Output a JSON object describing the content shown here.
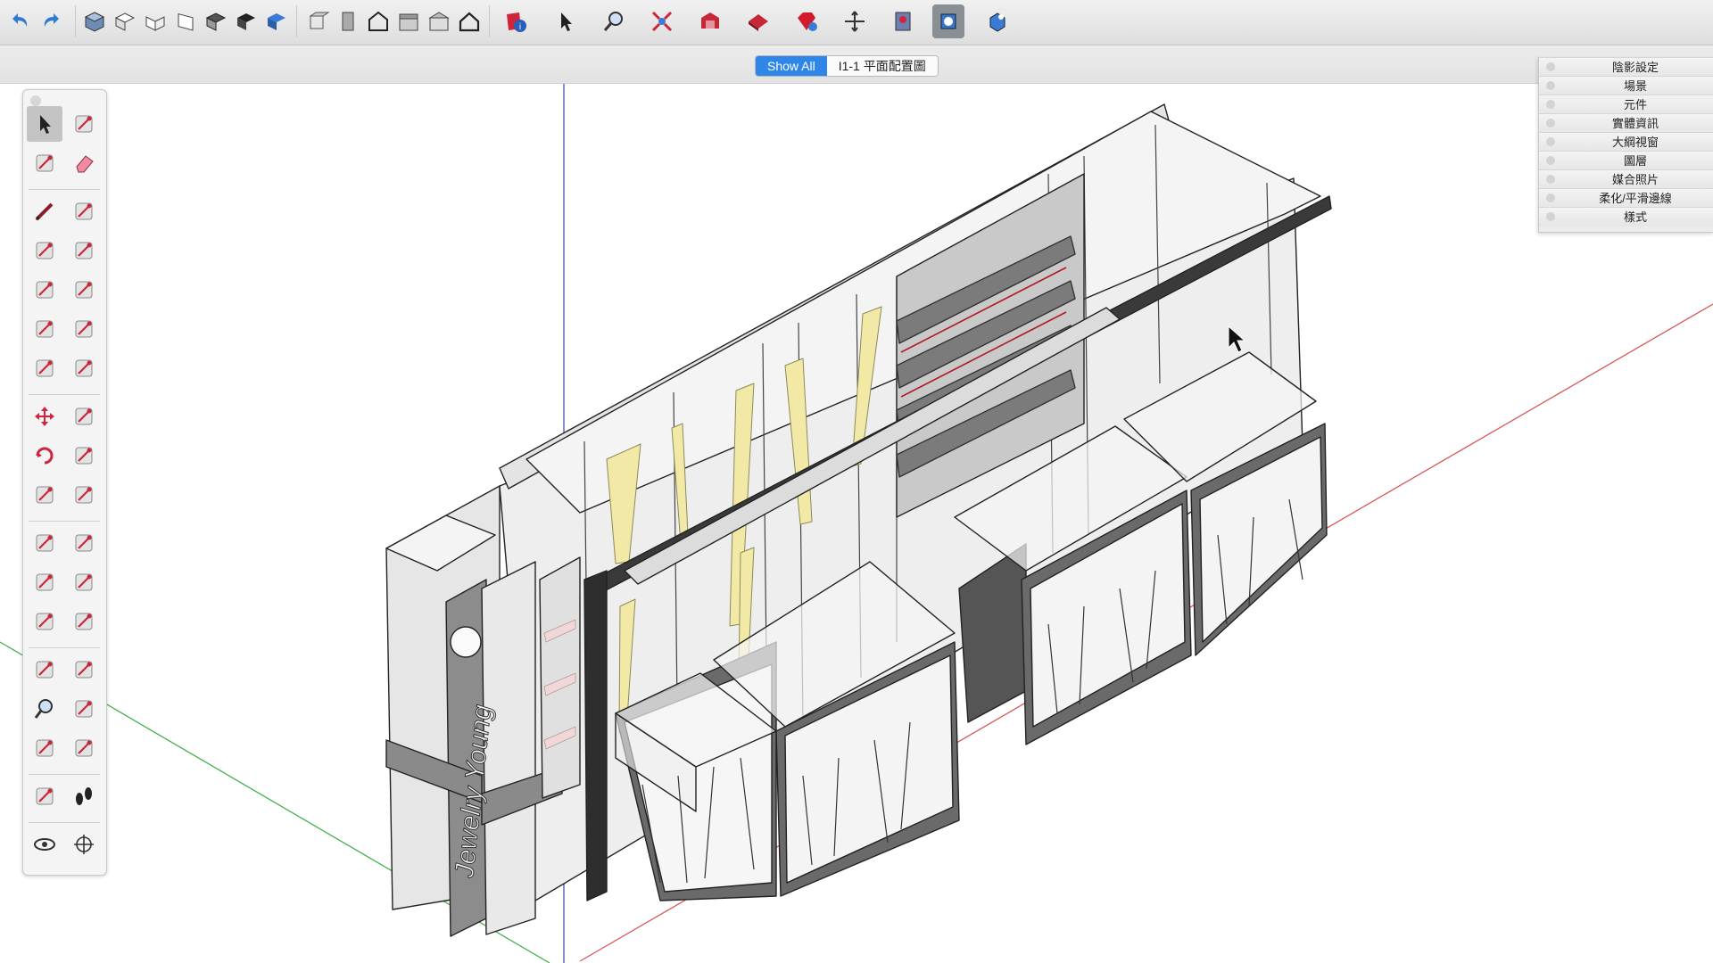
{
  "scene_tabs": {
    "show_all": "Show All",
    "scene_1": "I1-1 平面配置圖"
  },
  "tray": {
    "items": [
      "陰影設定",
      "場景",
      "元件",
      "實體資訊",
      "大綱視窗",
      "圖層",
      "媒合照片",
      "柔化/平滑邊線",
      "樣式"
    ]
  },
  "model": {
    "sign_text": "Jewelry Young"
  },
  "colors": {
    "accent_tab": "#2e86e9",
    "axis_red": "#d9575a",
    "axis_green": "#41b24a",
    "axis_blue": "#4a4ad0",
    "cabinet_light": "#e9e9e9",
    "cabinet_dark": "#545454",
    "light_panel": "#f3e9a6"
  },
  "icons": {
    "top_toolbar": [
      "undo-icon",
      "redo-icon",
      "iso-view-icon",
      "top-view-icon",
      "front-view-icon",
      "right-view-icon",
      "back-view-icon",
      "left-view-icon",
      "bottom-view-icon",
      "xray-style-icon",
      "wireframe-style-icon",
      "hidden-line-style-icon",
      "shaded-style-icon",
      "shaded-texture-style-icon",
      "monochrome-style-icon",
      "model-info-icon",
      "select-icon",
      "zoom-icon",
      "zoom-extents-icon",
      "warehouse-icon",
      "extension-warehouse-icon",
      "ruby-console-icon",
      "orbit-icon",
      "component-icon",
      "section-active-icon",
      "section-plane-icon"
    ],
    "tools": [
      "select-tool-icon",
      "component-tool-icon",
      "paint-bucket-icon",
      "eraser-icon",
      "pencil-icon",
      "freehand-icon",
      "rectangle-icon",
      "rotated-rectangle-icon",
      "circle-icon",
      "polygon-icon",
      "arc-icon",
      "pie-icon",
      "two-point-arc-icon",
      "three-point-arc-icon",
      "move-icon",
      "push-pull-icon",
      "rotate-icon",
      "follow-me-icon",
      "scale-icon",
      "offset-icon",
      "tape-measure-icon",
      "dimension-icon",
      "protractor-icon",
      "text-icon",
      "axes-icon",
      "3d-text-icon",
      "orbit-icon",
      "pan-icon",
      "zoom-icon",
      "zoom-window-icon",
      "zoom-extents-icon",
      "previous-view-icon",
      "position-camera-icon",
      "walk-icon",
      "look-around-icon",
      "section-plane-icon"
    ]
  }
}
